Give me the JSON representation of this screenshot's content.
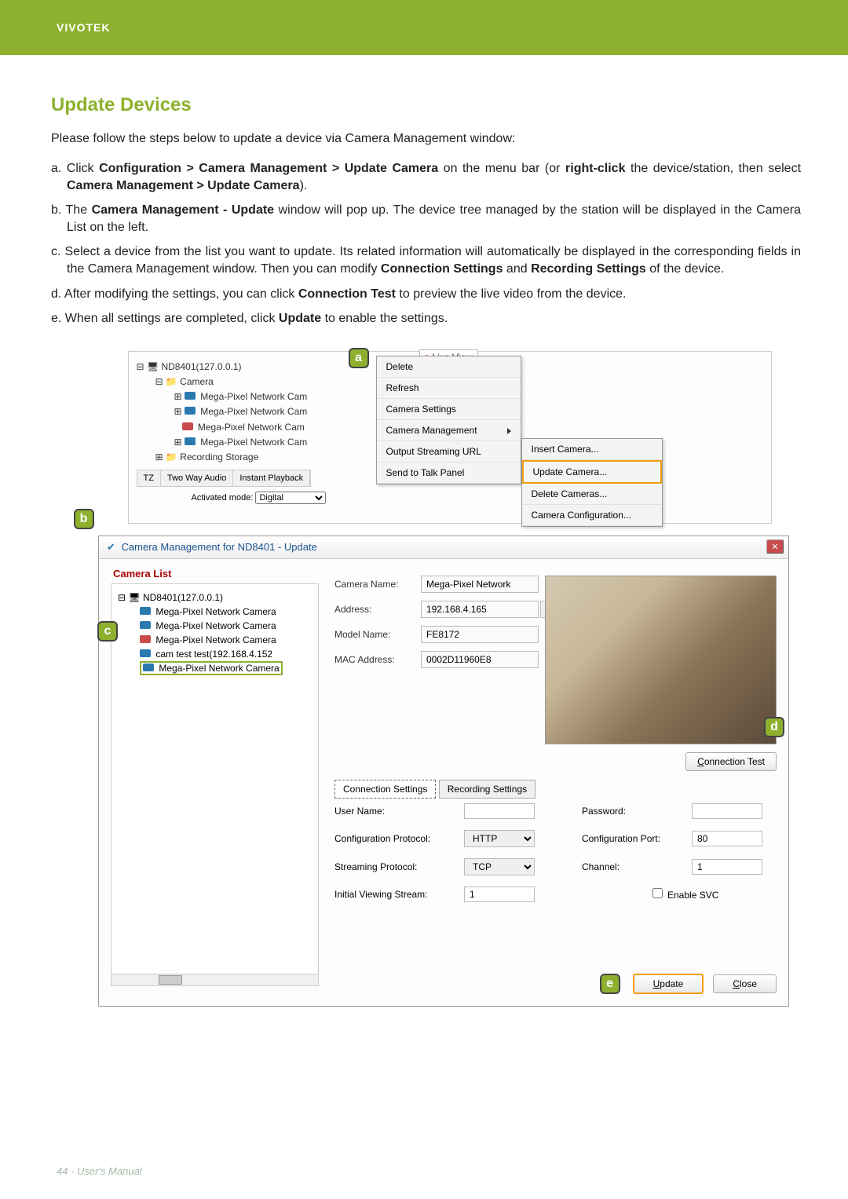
{
  "header": {
    "brand": "VIVOTEK"
  },
  "title": "Update Devices",
  "intro": "Please follow the steps below to update a device via Camera Management window:",
  "steps": [
    {
      "prefix": "a. ",
      "html": "Click <b>Configuration > Camera Management > Update Camera</b> on the menu bar (or <b>right-click</b> the device/station, then select <b>Camera Management > Update Camera</b>)."
    },
    {
      "prefix": "b. ",
      "html": "The <b>Camera Management - Update</b> window will pop up. The device tree managed by the station will be displayed in the Camera List on the left."
    },
    {
      "prefix": "c. ",
      "html": "Select a device from the list you want to update. Its related information will automatically be displayed in the corresponding fields in the Camera Management window. Then you can modify <b>Connection Settings</b> and <b>Recording Settings</b> of the device."
    },
    {
      "prefix": "d. ",
      "html": "After modifying the settings, you can click <b>Connection Test</b> to preview the live video from the device."
    },
    {
      "prefix": "e. ",
      "html": "When all settings are completed, click <b>Update</b> to enable the settings."
    }
  ],
  "annotations": {
    "a": "a",
    "b": "b",
    "c": "c",
    "d": "d",
    "e": "e"
  },
  "screenshot1": {
    "tree": {
      "root": "ND8401(127.0.0.1)",
      "folder": "Camera",
      "items": [
        "Mega-Pixel Network Cam",
        "Mega-Pixel Network Cam",
        "Mega-Pixel Network Cam",
        "Mega-Pixel Network Cam"
      ],
      "storage": "Recording Storage"
    },
    "tabs": {
      "tz": "TZ",
      "twoway": "Two Way Audio",
      "instant": "Instant Playback"
    },
    "mode_label": "Activated mode:",
    "mode_value": "Digital",
    "live_view": "Live View",
    "context_menu": [
      "Delete",
      "Refresh",
      "Camera Settings",
      "Camera Management",
      "Output Streaming URL",
      "Send to Talk Panel"
    ],
    "submenu": [
      "Insert Camera...",
      "Update Camera...",
      "Delete Cameras...",
      "Camera Configuration..."
    ]
  },
  "screenshot2": {
    "window_title": "Camera Management for ND8401 - Update",
    "close": "✕",
    "camera_list_label": "Camera List",
    "tree": {
      "root": "ND8401(127.0.0.1)",
      "items": [
        "Mega-Pixel Network Camera",
        "Mega-Pixel Network Camera",
        "Mega-Pixel Network Camera",
        "cam test test(192.168.4.152",
        "Mega-Pixel Network Camera"
      ]
    },
    "details": {
      "camera_name_label": "Camera Name:",
      "camera_name": "Mega-Pixel Network",
      "address_label": "Address:",
      "address": "192.168.4.165",
      "model_label": "Model Name:",
      "model": "FE8172",
      "mac_label": "MAC Address:",
      "mac": "0002D11960E8"
    },
    "connection_test": "Connection Test",
    "tabs": {
      "conn": "Connection Settings",
      "rec": "Recording Settings"
    },
    "conn": {
      "user_name_label": "User Name:",
      "user_name": "",
      "password_label": "Password:",
      "password": "",
      "cfg_proto_label": "Configuration Protocol:",
      "cfg_proto": "HTTP",
      "cfg_port_label": "Configuration Port:",
      "cfg_port": "80",
      "stream_proto_label": "Streaming Protocol:",
      "stream_proto": "TCP",
      "channel_label": "Channel:",
      "channel": "1",
      "initial_stream_label": "Initial Viewing Stream:",
      "initial_stream": "1",
      "enable_svc": "Enable SVC"
    },
    "buttons": {
      "update": "Update",
      "close": "Close"
    }
  },
  "footer": "44 - User's Manual"
}
